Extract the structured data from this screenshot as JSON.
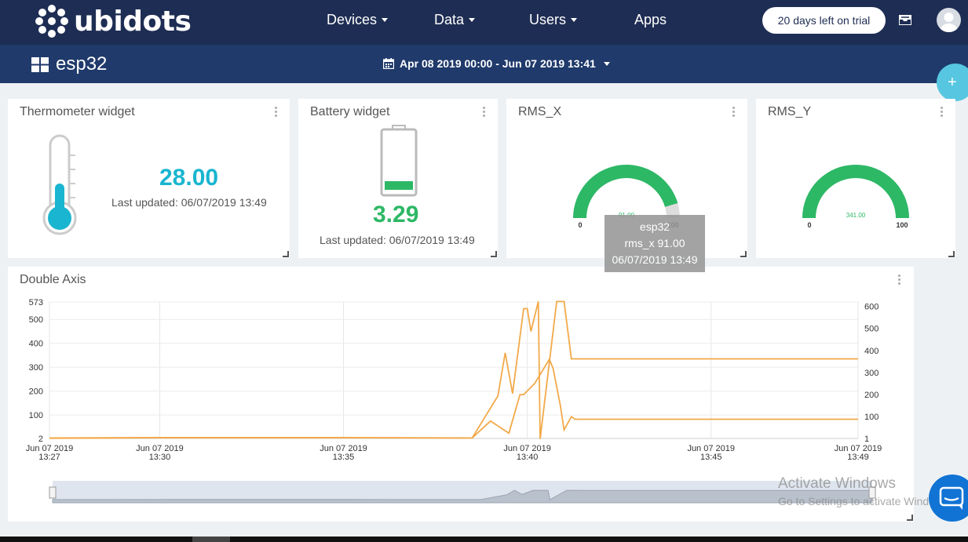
{
  "app": {
    "logo_text": "ubidots"
  },
  "nav": {
    "devices": "Devices",
    "data": "Data",
    "users": "Users",
    "apps": "Apps",
    "trial": "20 days left on trial"
  },
  "dashboard": {
    "name": "esp32",
    "date_range": "Apr 08 2019 00:00 - Jun 07 2019 13:41",
    "add_button": "+"
  },
  "widgets": {
    "thermometer": {
      "title": "Thermometer widget",
      "value": "28.00",
      "last_updated": "Last updated: 06/07/2019 13:49",
      "accent": "#1ab5d0"
    },
    "battery": {
      "title": "Battery widget",
      "value": "3.29",
      "last_updated": "Last updated: 06/07/2019 13:49",
      "accent": "#2db866"
    },
    "rms_x": {
      "title": "RMS_X",
      "value_label": "91.00",
      "min": "0",
      "max": "100",
      "value": 91,
      "color": "#2db866"
    },
    "rms_y": {
      "title": "RMS_Y",
      "value_label": "341.00",
      "min": "0",
      "max": "100",
      "value": 341,
      "color": "#2db866"
    },
    "double_axis": {
      "title": "Double Axis"
    }
  },
  "tooltip": {
    "device": "esp32",
    "reading": "rms_x 91.00",
    "timestamp": "06/07/2019 13:49"
  },
  "watermark": {
    "line1": "Activate Windows",
    "line2": "Go to Settings to activate Windows."
  },
  "chart_data": {
    "type": "line",
    "title": "Double Axis",
    "x_ticks": [
      {
        "date": "Jun 07 2019",
        "time": "13:27",
        "t": 0
      },
      {
        "date": "Jun 07 2019",
        "time": "13:30",
        "t": 3
      },
      {
        "date": "Jun 07 2019",
        "time": "13:35",
        "t": 8
      },
      {
        "date": "Jun 07 2019",
        "time": "13:40",
        "t": 13
      },
      {
        "date": "Jun 07 2019",
        "time": "13:45",
        "t": 18
      },
      {
        "date": "Jun 07 2019",
        "time": "13:49",
        "t": 22
      }
    ],
    "x_unit": "minutes after 13:27",
    "y_left": {
      "ticks": [
        "2",
        "100",
        "200",
        "300",
        "400",
        "500",
        "573"
      ],
      "range": [
        2,
        573
      ]
    },
    "y_right": {
      "ticks": [
        "1",
        "100",
        "200",
        "300",
        "400",
        "500",
        "600"
      ],
      "range": [
        1,
        620
      ]
    },
    "color": "#f2a94a",
    "grid": true,
    "series": [
      {
        "axis": "left",
        "points": [
          [
            0,
            3
          ],
          [
            3,
            5
          ],
          [
            8,
            5
          ],
          [
            11.5,
            4
          ],
          [
            12.2,
            180
          ],
          [
            12.4,
            360
          ],
          [
            12.6,
            190
          ],
          [
            12.9,
            545
          ],
          [
            13.0,
            545
          ],
          [
            13.1,
            450
          ],
          [
            13.3,
            575
          ],
          [
            13.35,
            0
          ],
          [
            13.8,
            575
          ],
          [
            14.0,
            575
          ],
          [
            14.2,
            335
          ],
          [
            14.3,
            335
          ],
          [
            22,
            335
          ]
        ]
      },
      {
        "axis": "right",
        "points": [
          [
            0,
            3
          ],
          [
            3,
            5
          ],
          [
            8,
            5
          ],
          [
            11.5,
            3
          ],
          [
            12.0,
            80
          ],
          [
            12.5,
            25
          ],
          [
            12.8,
            200
          ],
          [
            12.9,
            200
          ],
          [
            13.2,
            250
          ],
          [
            13.6,
            360
          ],
          [
            13.7,
            320
          ],
          [
            13.9,
            150
          ],
          [
            14.0,
            40
          ],
          [
            14.2,
            100
          ],
          [
            14.3,
            88
          ],
          [
            22,
            88
          ]
        ]
      }
    ]
  }
}
